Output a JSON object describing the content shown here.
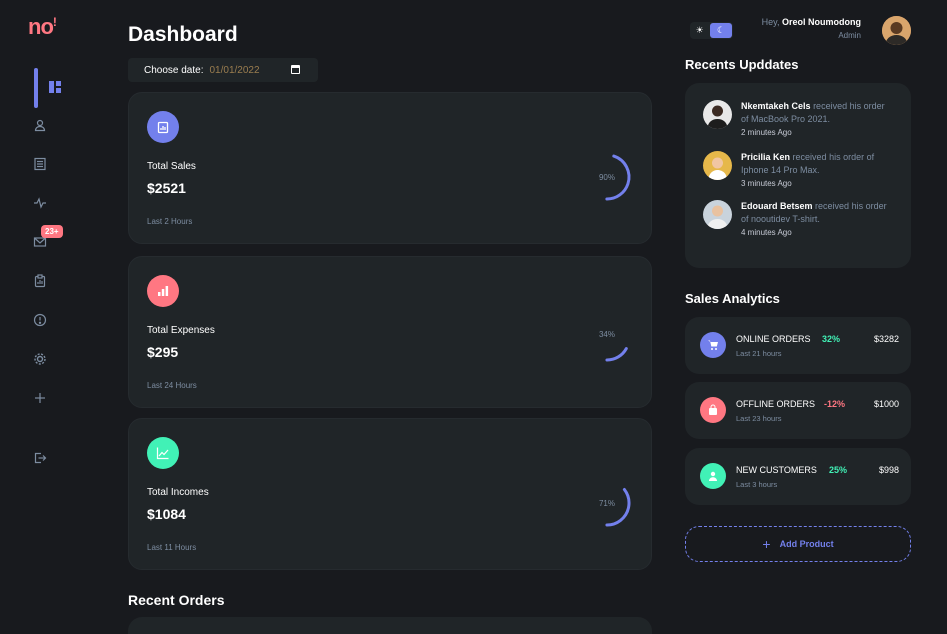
{
  "brand": {
    "logo": "no",
    "logo_mark": "!"
  },
  "sidebar": {
    "items": [
      {
        "id": "dashboard",
        "icon": "grid-icon",
        "active": true
      },
      {
        "id": "customers",
        "icon": "user-icon"
      },
      {
        "id": "orders",
        "icon": "receipt-icon"
      },
      {
        "id": "analytics",
        "icon": "pulse-icon"
      },
      {
        "id": "messages",
        "icon": "mail-icon",
        "badge": "23+"
      },
      {
        "id": "products",
        "icon": "clipboard-icon"
      },
      {
        "id": "reports",
        "icon": "alert-icon"
      },
      {
        "id": "settings",
        "icon": "gear-icon"
      },
      {
        "id": "add",
        "icon": "plus-icon"
      },
      {
        "id": "logout",
        "icon": "logout-icon"
      }
    ]
  },
  "header": {
    "title": "Dashboard",
    "date_label": "Choose date:",
    "date_value": "01/01/2022"
  },
  "cards": [
    {
      "name": "sales",
      "title": "Total Sales",
      "amount": "$2521",
      "footer": "Last 2 Hours",
      "percent_label": "90%",
      "percent": 90,
      "color": "#7380ec"
    },
    {
      "name": "expenses",
      "title": "Total Expenses",
      "amount": "$295",
      "footer": "Last 24 Hours",
      "percent_label": "34%",
      "percent": 34,
      "color": "#ff7782"
    },
    {
      "name": "incomes",
      "title": "Total Incomes",
      "amount": "$1084",
      "footer": "Last 11 Hours",
      "percent_label": "71%",
      "percent": 71,
      "color": "#41f1b6"
    }
  ],
  "recent_orders": {
    "title": "Recent Orders"
  },
  "profile": {
    "greeting": "Hey,",
    "name": "Oreol Noumodong",
    "role": "Admin"
  },
  "theme": {
    "light_icon": "☀",
    "dark_icon": "☾"
  },
  "updates": {
    "title": "Recents Upddates",
    "items": [
      {
        "name": "Nkemtakeh Cels",
        "text": "received his order of MacBook Pro 2021.",
        "time": "2 minutes Ago"
      },
      {
        "name": "Pricilia Ken",
        "text": "received his order of Iphone 14 Pro Max.",
        "time": "3 minutes Ago"
      },
      {
        "name": "Edouard Betsem",
        "text": "received his order of nooutidev T-shirt.",
        "time": "4 minutes Ago"
      }
    ]
  },
  "analytics": {
    "title": "Sales Analytics",
    "items": [
      {
        "name": "ONLINE ORDERS",
        "sub": "Last 21 hours",
        "pct": "32%",
        "value": "$3282",
        "positive": true,
        "color": "#7380ec",
        "icon": "cart-icon"
      },
      {
        "name": "OFFLINE ORDERS",
        "sub": "Last 23 hours",
        "pct": "-12%",
        "value": "$1000",
        "positive": false,
        "color": "#ff7782",
        "icon": "bag-icon"
      },
      {
        "name": "NEW CUSTOMERS",
        "sub": "Last 3 hours",
        "pct": "25%",
        "value": "$998",
        "positive": true,
        "color": "#41f1b6",
        "icon": "person-icon"
      }
    ]
  },
  "add_product": {
    "label": "Add Product"
  },
  "colors": {
    "primary": "#7380ec",
    "danger": "#ff7782",
    "success": "#41f1b6",
    "background": "#181a1e",
    "panel": "#202528"
  }
}
